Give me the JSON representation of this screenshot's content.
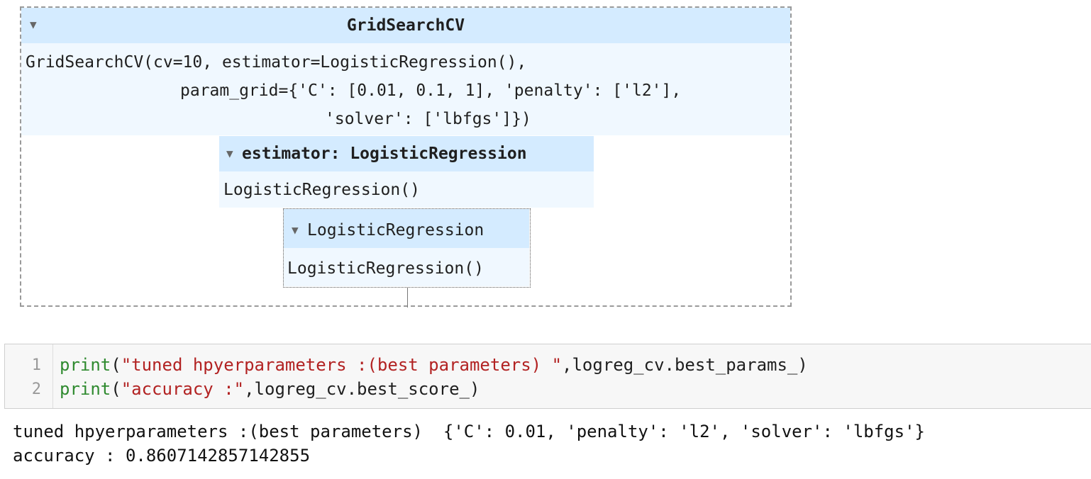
{
  "diagram": {
    "title": "GridSearchCV",
    "repr_lines": [
      "GridSearchCV(cv=10, estimator=LogisticRegression(),",
      "param_grid={'C': [0.01, 0.1, 1], 'penalty': ['l2'],",
      "'solver': ['lbfgs']})"
    ],
    "estimator_label": "estimator: LogisticRegression",
    "estimator_repr": "LogisticRegression()",
    "inner_label": "LogisticRegression",
    "inner_repr": "LogisticRegression()",
    "toggle_icon": "triangle-down-icon"
  },
  "code_cell": {
    "line_numbers": [
      "1",
      "2"
    ],
    "line1": {
      "func": "print",
      "open": "(",
      "string": "\"tuned hpyerparameters :(best parameters) \"",
      "rest": ",logreg_cv.best_params_)"
    },
    "line2": {
      "func": "print",
      "open": "(",
      "string": "\"accuracy :\"",
      "rest": ",logreg_cv.best_score_)"
    }
  },
  "output": {
    "lines": [
      "tuned hpyerparameters :(best parameters)  {'C': 0.01, 'penalty': 'l2', 'solver': 'lbfgs'}",
      "accuracy : 0.8607142857142855"
    ]
  },
  "colors": {
    "toggle_bg": "#d4ebff",
    "repr_bg": "#f0f8ff",
    "keyword": "#2f8a2f",
    "string": "#b22222"
  }
}
